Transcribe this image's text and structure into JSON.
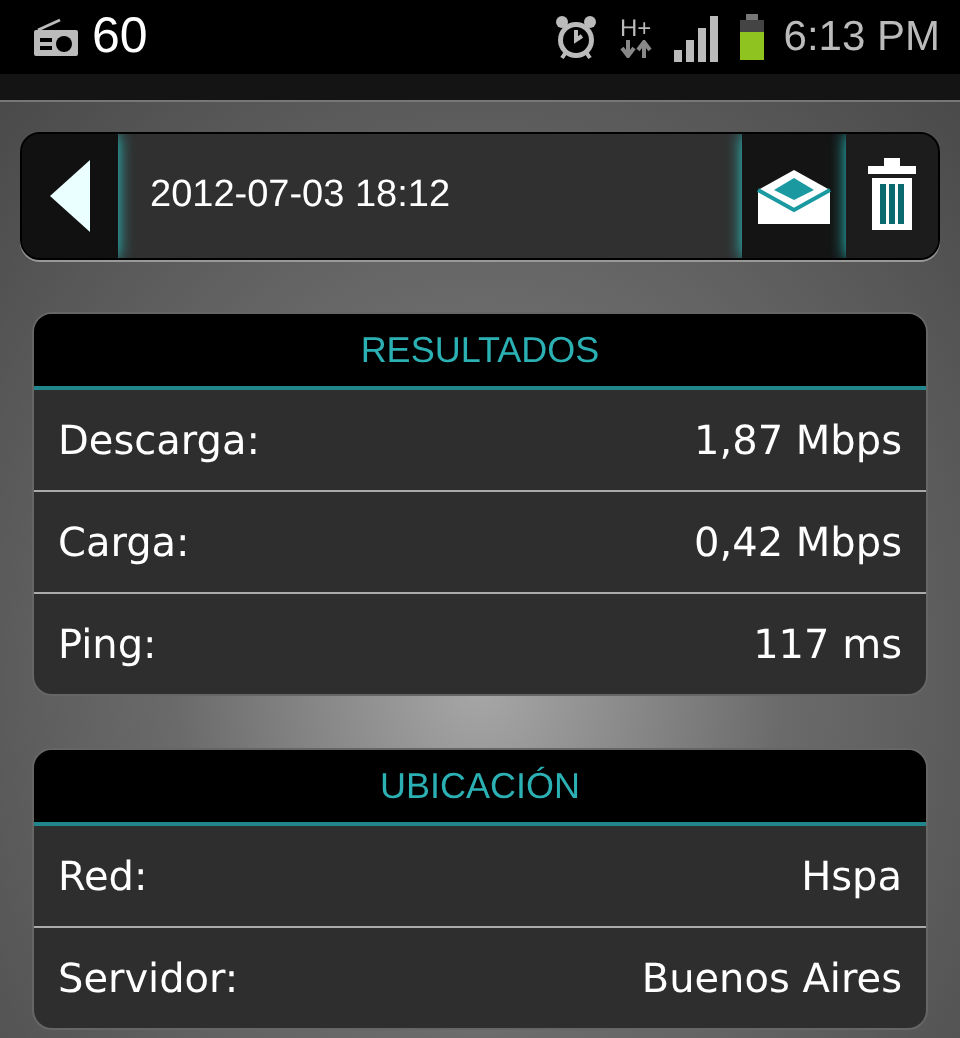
{
  "status_bar": {
    "notification_count": "60",
    "network_type": "H+",
    "time": "6:13 PM"
  },
  "toolbar": {
    "title": "2012-07-03 18:12"
  },
  "sections": [
    {
      "title": "RESULTADOS",
      "rows": [
        {
          "label": "Descarga:",
          "value": "1,87 Mbps"
        },
        {
          "label": "Carga:",
          "value": "0,42 Mbps"
        },
        {
          "label": "Ping:",
          "value": "117 ms"
        }
      ]
    },
    {
      "title": "UBICACIÓN",
      "rows": [
        {
          "label": "Red:",
          "value": "Hspa"
        },
        {
          "label": "Servidor:",
          "value": "Buenos Aires"
        }
      ]
    }
  ]
}
